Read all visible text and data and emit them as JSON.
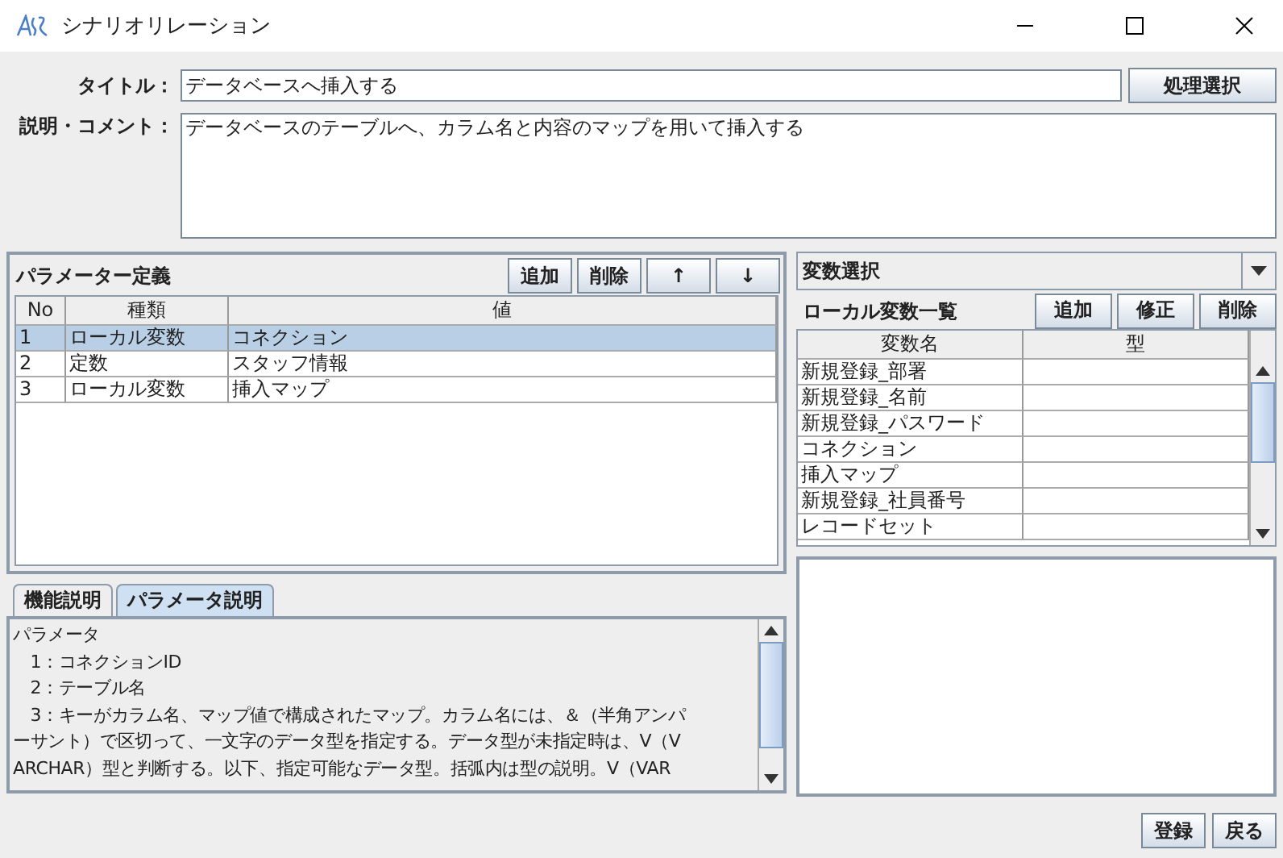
{
  "window": {
    "title": "シナリオリレーション"
  },
  "form": {
    "title_label": "タイトル：",
    "title_value": "データベースへ挿入する",
    "select_button": "処理選択",
    "comment_label": "説明・コメント：",
    "comment_value": "データベースのテーブルへ、カラム名と内容のマップを用いて挿入する"
  },
  "parameters": {
    "title": "パラメーター定義",
    "buttons": [
      "追加",
      "削除",
      "↑",
      "↓"
    ],
    "columns": [
      "No",
      "種類",
      "値"
    ],
    "rows": [
      {
        "cells": [
          "1",
          "ローカル変数",
          "コネクション"
        ],
        "selected": true
      },
      {
        "cells": [
          "2",
          "定数",
          "スタッフ情報"
        ],
        "selected": false
      },
      {
        "cells": [
          "3",
          "ローカル変数",
          "挿入マップ"
        ],
        "selected": false
      }
    ]
  },
  "description": {
    "tabs": [
      {
        "label": "機能説明",
        "selected": false
      },
      {
        "label": "パラメータ説明",
        "selected": true
      }
    ],
    "lines": [
      "パラメータ",
      "　1：コネクションID",
      "　2：テーブル名",
      "　3：キーがカラム名、マップ値で構成されたマップ。カラム名には、＆（半角アンパ",
      "ーサント）で区切って、一文字のデータ型を指定する。データ型が未指定時は、V（V",
      "ARCHAR）型と判断する。以下、指定可能なデータ型。括弧内は型の説明。V（VAR"
    ]
  },
  "variable_select": {
    "value": "変数選択"
  },
  "local_variables": {
    "title": "ローカル変数一覧",
    "buttons": [
      "追加",
      "修正",
      "削除"
    ],
    "columns": [
      "変数名",
      "型"
    ],
    "rows": [
      "新規登録_部署",
      "新規登録_名前",
      "新規登録_パスワード",
      "コネクション",
      "挿入マップ",
      "新規登録_社員番号",
      "レコードセット"
    ]
  },
  "footer_buttons": [
    "登録",
    "戻る"
  ]
}
